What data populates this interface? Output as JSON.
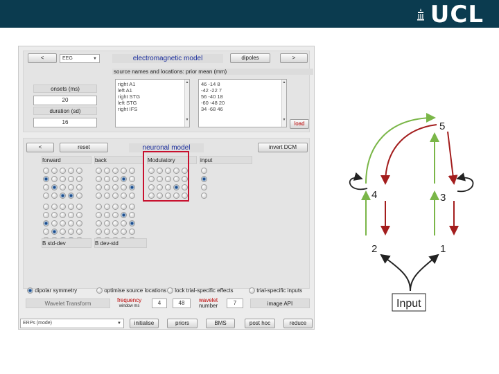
{
  "banner": {
    "logo_text": "UCL",
    "bg_color": "#0b3b4f"
  },
  "em_model": {
    "left_arrow": "<",
    "modality": "EEG",
    "title": "electromagnetic model",
    "dipoles_label": "dipoles",
    "right_arrow": ">",
    "source_header": "source names and locations: prior mean (mm)",
    "onsets_label": "onsets (ms)",
    "onsets_value": "20",
    "duration_label": "duration (sd)",
    "duration_value": "16",
    "source_names": [
      "right A1",
      "left A1",
      "right STG",
      "left STG",
      "right IFS"
    ],
    "source_locations": [
      "46 -14  8",
      "-42 -22  7",
      "56 -40  18",
      "-60 -48  20",
      "34 -68  46"
    ],
    "load_label": "load"
  },
  "neuronal_model": {
    "back_arrow": "<",
    "reset_label": "reset",
    "title": "neuronal model",
    "invert_label": "invert DCM",
    "col_forward": "forward",
    "col_back": "back",
    "col_modulatory": "Modulatory",
    "col_input": "input",
    "b_label_1": "B std-dev",
    "b_label_2": "B dev-std"
  },
  "options": {
    "dipolar_symmetry": "dipolar symmetry",
    "optimise_source_locations": "optimise source locations",
    "lock_trial_specific": "lock trial-specific effects",
    "trial_specific_inputs": "trial-specific inputs",
    "wavelet_transform": "Wavelet Transform",
    "frequency_label": "frequency",
    "frequency_sub": "window ms",
    "freq_low": "4",
    "freq_high": "48",
    "wavelet_label": "wavelet",
    "wavelet_sub": "number",
    "wavelet_number": "7",
    "image_api": "image API"
  },
  "bottom": {
    "mode": "ERPs (mode)",
    "initialise": "initialise",
    "priors": "priors",
    "bms": "BMS",
    "post_hoc": "post hoc",
    "reduce": "reduce"
  },
  "graph": {
    "node_5": "5",
    "node_4": "4",
    "node_3": "3",
    "node_2": "2",
    "node_1": "1",
    "input": "Input",
    "forward_color": "#7ab648",
    "backward_color": "#a31d1d",
    "input_color": "#222222",
    "highlight_color": "#c8102e"
  }
}
